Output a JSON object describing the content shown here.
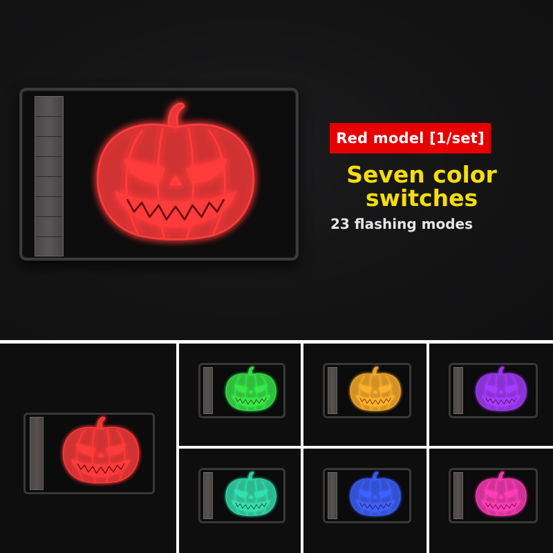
{
  "badge": {
    "label": "Red model [1/set]"
  },
  "headline": {
    "line1": "Seven color",
    "line2": "switches"
  },
  "subline": {
    "label": "23 flashing modes"
  },
  "colors": {
    "red": "#ff3b3b",
    "green": "#39e84a",
    "orange": "#ffb02e",
    "purple": "#a63cff",
    "teal": "#35e0b0",
    "blue": "#3d62ff",
    "pink": "#ff3db8",
    "badge_bg": "#e60000",
    "headline": "#f6dd08"
  },
  "variants": [
    {
      "name": "red",
      "icon": "jack-o-lantern-icon"
    },
    {
      "name": "green",
      "icon": "jack-o-lantern-icon"
    },
    {
      "name": "orange",
      "icon": "jack-o-lantern-icon"
    },
    {
      "name": "purple",
      "icon": "jack-o-lantern-icon"
    },
    {
      "name": "teal",
      "icon": "jack-o-lantern-icon"
    },
    {
      "name": "blue",
      "icon": "jack-o-lantern-icon"
    },
    {
      "name": "pink",
      "icon": "jack-o-lantern-icon"
    }
  ]
}
